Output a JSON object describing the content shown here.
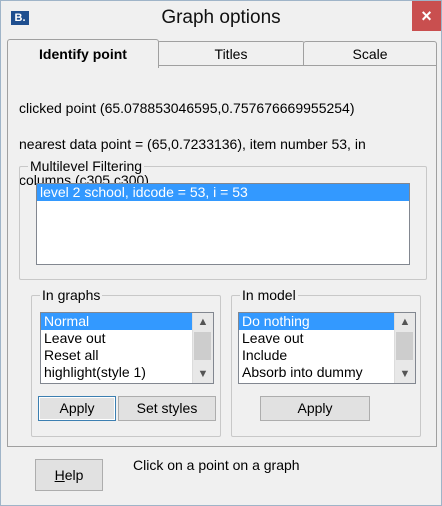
{
  "window": {
    "title": "Graph options",
    "close_glyph": "×",
    "app_icon_glyph": "B."
  },
  "tabs": [
    {
      "label": "Identify point",
      "active": true
    },
    {
      "label": "Titles",
      "active": false
    },
    {
      "label": "Scale",
      "active": false
    }
  ],
  "identify": {
    "clicked_point_text": "clicked point (65.078853046595,0.757676669955254)",
    "nearest_text": "nearest data point = (65,0.7233136), item number 53, in",
    "columns_text": "columns (c305,c300)"
  },
  "multilevel_filtering": {
    "title": "Multilevel Filtering",
    "items": [
      "level 2  school, idcode = 53,    i = 53"
    ]
  },
  "in_graphs": {
    "title": "In graphs",
    "items": [
      "Normal",
      "Leave out",
      "Reset all",
      "highlight(style 1)"
    ],
    "selected_index": 0,
    "apply_label": "Apply",
    "set_styles_label": "Set styles"
  },
  "in_model": {
    "title": "In model",
    "items": [
      "Do nothing",
      "Leave out",
      "Include",
      "Absorb into dummy"
    ],
    "selected_index": 0,
    "apply_label": "Apply"
  },
  "footer": {
    "help_label_prefix": "",
    "help_label_underlined": "H",
    "help_label_rest": "elp",
    "status_text": "Click on a point on a graph"
  },
  "icons": {
    "scroll_up": "▲",
    "scroll_down": "▼"
  },
  "colors": {
    "selection": "#3399ff",
    "close_button": "#c94f4f"
  }
}
